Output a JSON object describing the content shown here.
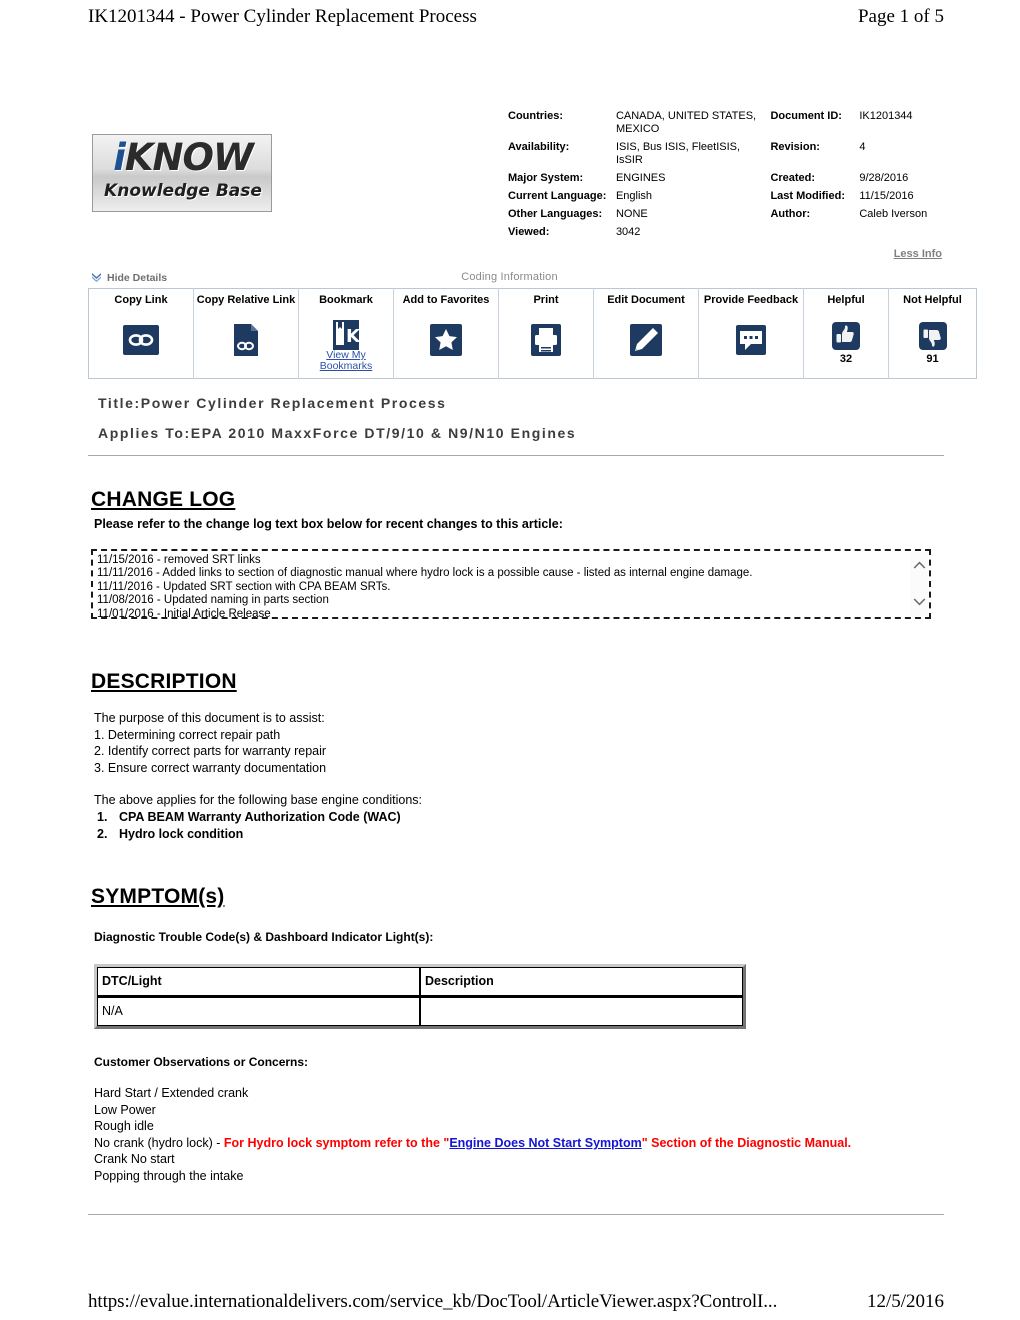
{
  "page": {
    "header_title": "IK1201344 - Power Cylinder Replacement Process",
    "header_pagination": "Page 1 of 5",
    "footer_url": "https://evalue.internationaldelivers.com/service_kb/DocTool/ArticleViewer.aspx?ControlI...",
    "footer_date": "12/5/2016"
  },
  "logo": {
    "top_i": "i",
    "top_rest": "KNOW",
    "bottom": "Knowledge Base"
  },
  "metadata": {
    "rows": [
      {
        "label": "Countries:",
        "value": "CANADA, UNITED STATES, MEXICO",
        "label2": "Document ID:",
        "value2": "IK1201344"
      },
      {
        "label": "Availability:",
        "value": "ISIS, Bus ISIS, FleetISIS, IsSIR",
        "label2": "Revision:",
        "value2": "4"
      },
      {
        "label": "Major System:",
        "value": "ENGINES",
        "label2": "Created:",
        "value2": "9/28/2016"
      },
      {
        "label": "Current Language:",
        "value": "English",
        "label2": "Last Modified:",
        "value2": "11/15/2016"
      },
      {
        "label": "Other Languages:",
        "value": "NONE",
        "label2": "Author:",
        "value2": "Caleb Iverson"
      },
      {
        "label": "Viewed:",
        "value": "3042",
        "label2": "",
        "value2": ""
      }
    ],
    "less_info": "Less Info"
  },
  "toolbar": {
    "hide_details": "Hide Details",
    "coding_information": "Coding Information",
    "items": [
      {
        "label": "Copy Link",
        "icon": "chain-link-icon",
        "sublink": "",
        "count": ""
      },
      {
        "label": "Copy Relative Link",
        "icon": "document-link-icon",
        "sublink": "",
        "count": ""
      },
      {
        "label": "Bookmark",
        "icon": "bookmark-ik-icon",
        "sublink": "View My Bookmarks",
        "count": ""
      },
      {
        "label": "Add to Favorites",
        "icon": "star-icon",
        "sublink": "",
        "count": ""
      },
      {
        "label": "Print",
        "icon": "printer-icon",
        "sublink": "",
        "count": ""
      },
      {
        "label": "Edit Document",
        "icon": "pencil-icon",
        "sublink": "",
        "count": ""
      },
      {
        "label": "Provide Feedback",
        "icon": "comment-icon",
        "sublink": "",
        "count": ""
      },
      {
        "label": "Helpful",
        "icon": "thumbs-up-icon",
        "sublink": "",
        "count": "32"
      },
      {
        "label": "Not Helpful",
        "icon": "thumbs-down-icon",
        "sublink": "",
        "count": "91"
      }
    ]
  },
  "article": {
    "title_label": "Title:",
    "title_value": "Power Cylinder Replacement Process",
    "applies_label": "Applies To:",
    "applies_value": "EPA 2010 MaxxForce DT/9/10 & N9/N10 Engines"
  },
  "change_log": {
    "heading": "CHANGE LOG",
    "intro": "Please refer to the change log text box below for recent changes to this article:",
    "entries": [
      "11/15/2016 - removed SRT links",
      "11/11/2016 - Added links to section of diagnostic manual where hydro lock is a possible cause - listed as internal engine damage.",
      "11/11/2016 - Updated SRT section with CPA BEAM SRTs.",
      "11/08/2016 - Updated naming in parts section",
      "11/01/2016 - Initial Article Release"
    ]
  },
  "description": {
    "heading": "DESCRIPTION",
    "purpose_intro": "The purpose of this document is to assist:",
    "purpose_items": [
      "1. Determining correct repair path",
      "2. Identify correct parts for warranty repair",
      "3. Ensure correct warranty documentation"
    ],
    "conditions_intro": "The above applies for the following base engine conditions:",
    "conditions": [
      {
        "num": "1.",
        "text": "CPA BEAM Warranty Authorization Code (WAC)"
      },
      {
        "num": "2.",
        "text": "Hydro lock condition"
      }
    ]
  },
  "symptoms": {
    "heading": "SYMPTOM(s)",
    "dtc_subtitle": "Diagnostic Trouble Code(s) & Dashboard Indicator Light(s):",
    "dtc_table": {
      "columns": [
        "DTC/Light",
        "Description"
      ],
      "rows": [
        [
          "N/A",
          ""
        ]
      ]
    },
    "observations_title": "Customer Observations or Concerns:",
    "observations": [
      "Hard Start / Extended crank",
      "Low Power",
      "Rough idle"
    ],
    "hydro_lock_line": {
      "plain_prefix": "No crank (hydro lock) - ",
      "red_before": "For Hydro lock symptom refer to the \"",
      "link_text": "Engine Does Not Start Symptom",
      "red_after": "\" Section of the Diagnostic Manual."
    },
    "observations_tail": [
      "Crank No start",
      "Popping through the intake"
    ]
  },
  "colors": {
    "icon_navy": "#1f3a61",
    "link_blue": "#2a4fa8",
    "alert_red": "#ff0000",
    "inline_link_blue": "#1414d6",
    "muted_gray": "#8a8a8a"
  }
}
